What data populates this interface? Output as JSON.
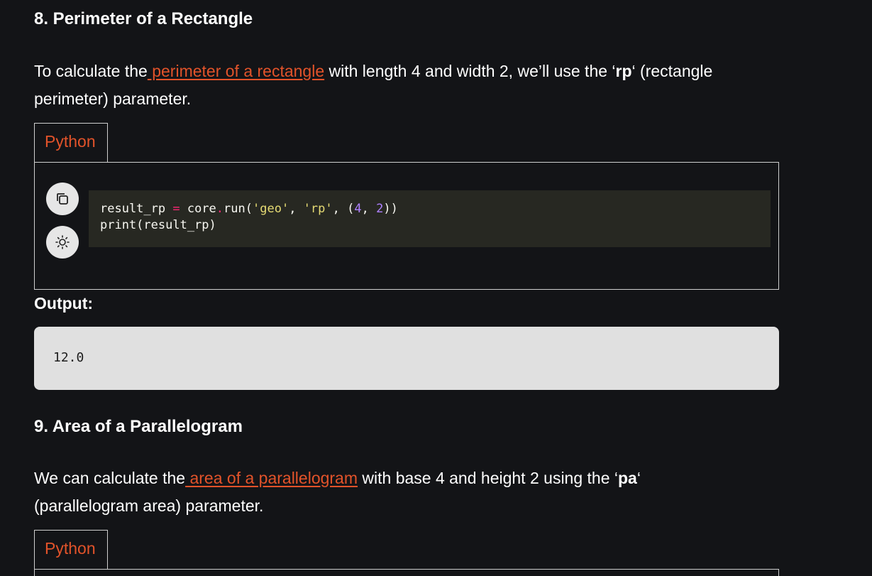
{
  "section8": {
    "heading": "8. Perimeter of a Rectangle",
    "para_prefix": "To calculate the",
    "link_text": " perimeter of a rectangle",
    "para_mid": " with length 4 and width 2, we’ll use the ‘",
    "param": "rp",
    "para_suffix": "‘ (rectangle perimeter) parameter.",
    "tab_label": "Python",
    "code": {
      "line1": {
        "var": "result_rp ",
        "eq": "=",
        "call_a": " core",
        "dot": ".",
        "call_b": "run(",
        "s1": "'geo'",
        "comma1": ", ",
        "s2": "'rp'",
        "comma2": ", (",
        "n1": "4",
        "comma3": ", ",
        "n2": "2",
        "close": "))"
      },
      "line2": "print(result_rp)"
    },
    "output_label": "Output:",
    "output_value": "12.0"
  },
  "section9": {
    "heading": "9. Area of a Parallelogram",
    "para_prefix": "We can calculate the",
    "link_text": " area of a parallelogram",
    "para_mid": " with base 4 and height 2 using the ‘",
    "param": "pa",
    "para_suffix": "‘ (parallelogram area) parameter.",
    "tab_label": "Python"
  },
  "icons": {
    "copy": "copy-icon",
    "theme": "sun-icon"
  },
  "colors": {
    "background": "#131417",
    "accent_link": "#e2532a",
    "code_bg": "#272822",
    "output_bg": "#e0e0e0"
  }
}
